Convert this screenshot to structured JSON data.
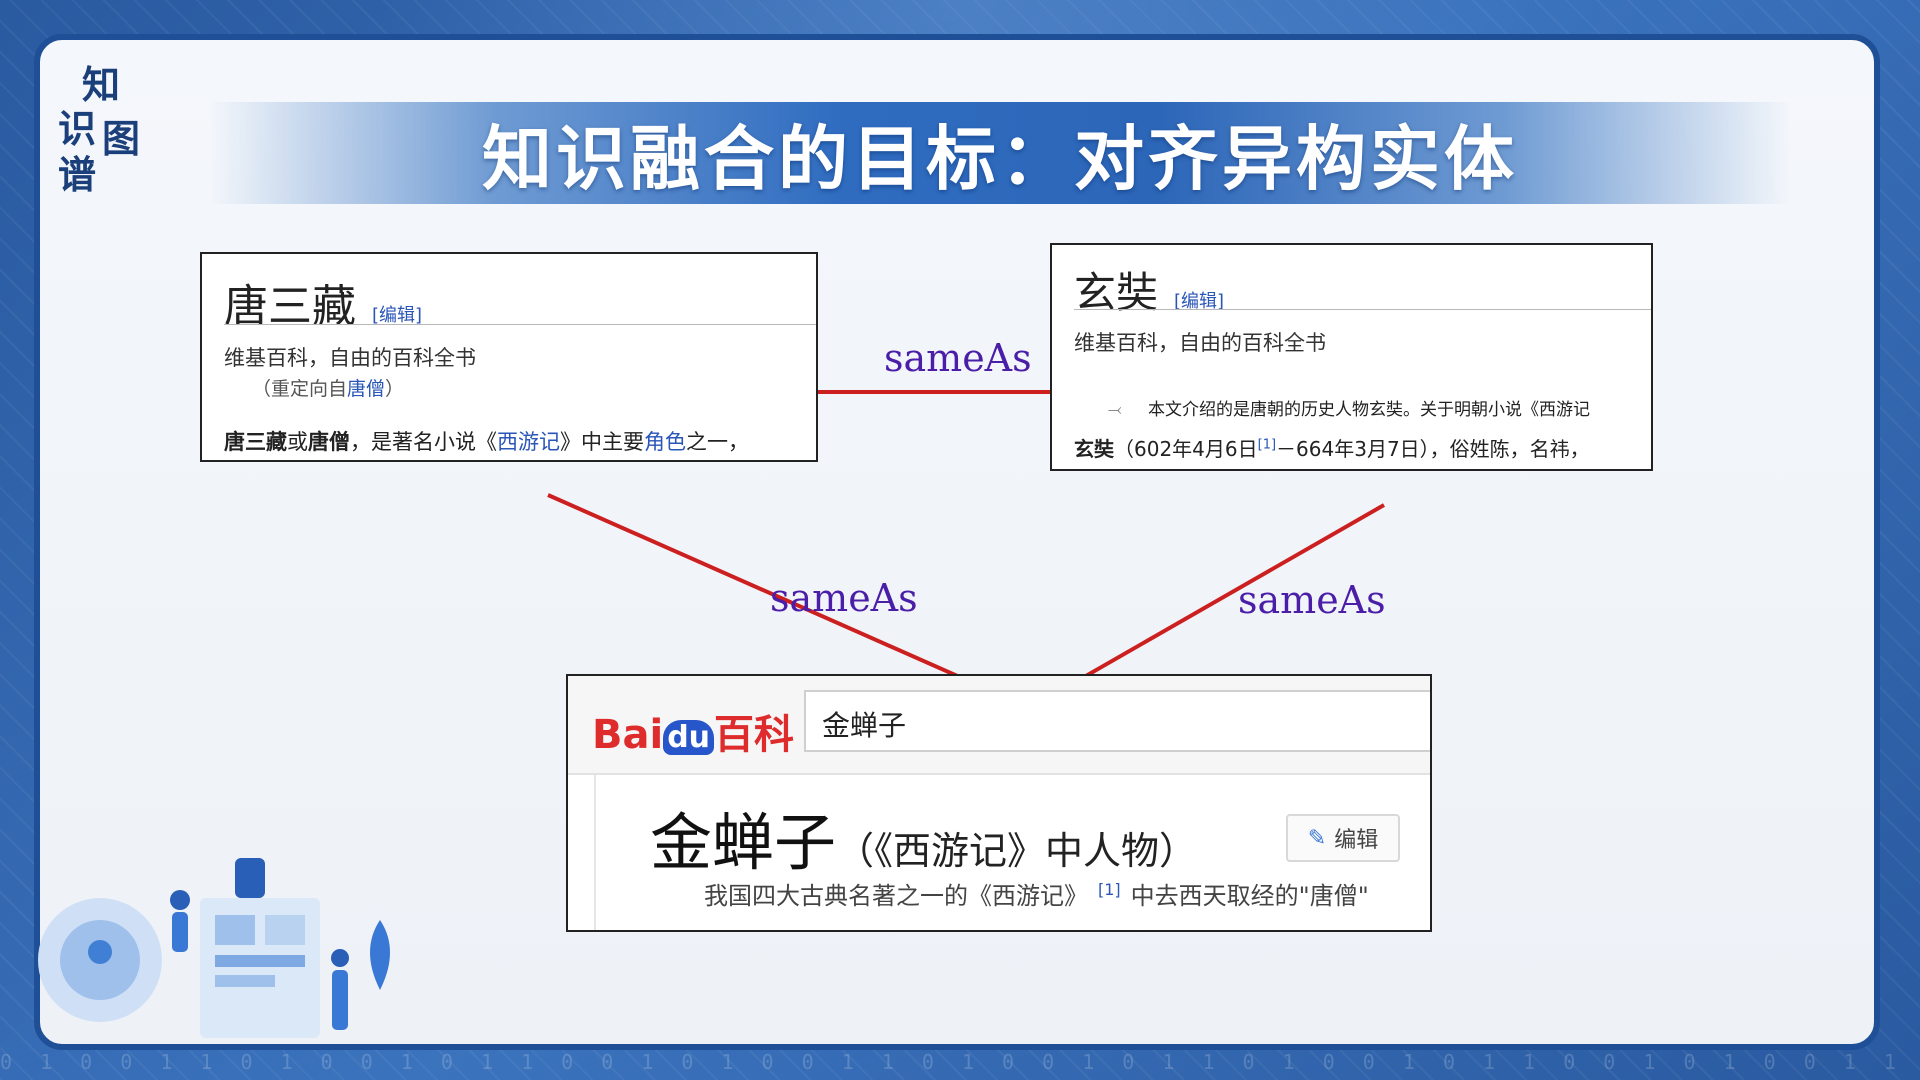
{
  "logo": {
    "chars": [
      "知",
      "识",
      "图",
      "谱"
    ]
  },
  "title": "知识融合的目标：对齐异构实体",
  "relation_label": "sameAs",
  "card_tangsanzang": {
    "heading": "唐三藏",
    "edit": "[编辑]",
    "source": "维基百科，自由的百科全书",
    "redirect_prefix": "（重定向自",
    "redirect_link": "唐僧",
    "redirect_suffix": "）",
    "line_bold": "唐三藏",
    "line_or": "或",
    "line_bold2": "唐僧",
    "line_mid": "，是著名小说《",
    "line_link": "西游记",
    "line_mid2": "》中主要",
    "line_link2": "角色",
    "line_end": "之一，"
  },
  "card_xuanzang": {
    "heading": "玄奘",
    "edit": "[编辑]",
    "source": "维基百科，自由的百科全书",
    "note": "本文介绍的是唐朝的历史人物玄奘。关于明朝小说《西游记",
    "line_bold": "玄奘",
    "line_a": "（602年4月6日",
    "line_sup": "[1]",
    "line_b": "－664年3月7日），俗姓陈，名祎，"
  },
  "card_jinchanzi": {
    "logo_bai": "Bai",
    "logo_du": "du",
    "logo_baike": "百科",
    "search_value": "金蝉子",
    "title": "金蝉子",
    "subtitle": "（《西游记》中人物）",
    "edit": "编辑",
    "desc_a": "我国四大古典名著之一的《西游记》",
    "desc_sup": "[1]",
    "desc_b": "中去西天取经的\"唐僧\""
  },
  "colors": {
    "link_line": "#cc1f1f",
    "relation_text": "#4b1ea8",
    "accent": "#2c66b8",
    "baidu_red": "#de2c2c",
    "baidu_blue": "#2656c9"
  }
}
